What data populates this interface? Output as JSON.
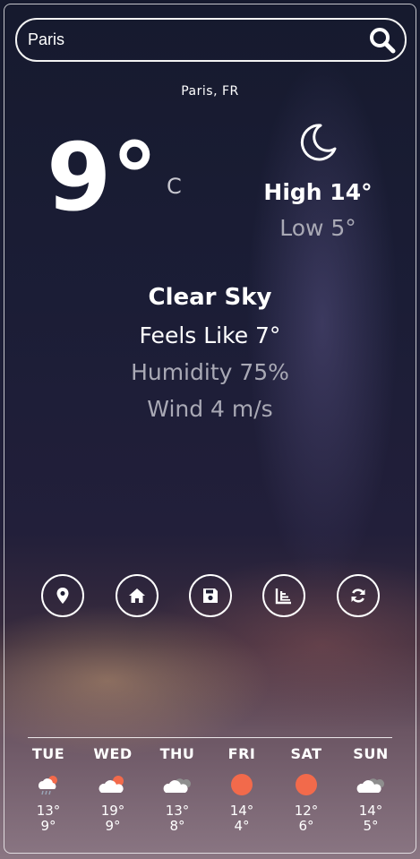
{
  "search": {
    "value": "Paris"
  },
  "location": "Paris, FR",
  "current": {
    "temp": "9°",
    "unit": "C",
    "high": "High 14°",
    "low": "Low 5°",
    "condition": "Clear Sky",
    "feels_like": "Feels Like 7°",
    "humidity": "Humidity 75%",
    "wind": "Wind 4 m/s",
    "icon": "moon-icon"
  },
  "actions": [
    {
      "name": "location",
      "icon": "map-pin-icon"
    },
    {
      "name": "home",
      "icon": "home-icon"
    },
    {
      "name": "save",
      "icon": "floppy-disk-icon"
    },
    {
      "name": "chart",
      "icon": "bar-chart-icon"
    },
    {
      "name": "refresh",
      "icon": "refresh-icon"
    }
  ],
  "forecast": [
    {
      "day": "TUE",
      "high": "13°",
      "low": "9°",
      "icon": "rain-cloud-sun-icon"
    },
    {
      "day": "WED",
      "high": "19°",
      "low": "9°",
      "icon": "cloud-sun-icon"
    },
    {
      "day": "THU",
      "high": "13°",
      "low": "8°",
      "icon": "cloudy-icon"
    },
    {
      "day": "FRI",
      "high": "14°",
      "low": "4°",
      "icon": "sun-icon"
    },
    {
      "day": "SAT",
      "high": "12°",
      "low": "6°",
      "icon": "sun-icon"
    },
    {
      "day": "SUN",
      "high": "14°",
      "low": "5°",
      "icon": "cloudy-icon"
    }
  ],
  "colors": {
    "sun": "#f26a4b",
    "cloud": "#ffffff",
    "cloud_dark": "#9a9a9a"
  }
}
